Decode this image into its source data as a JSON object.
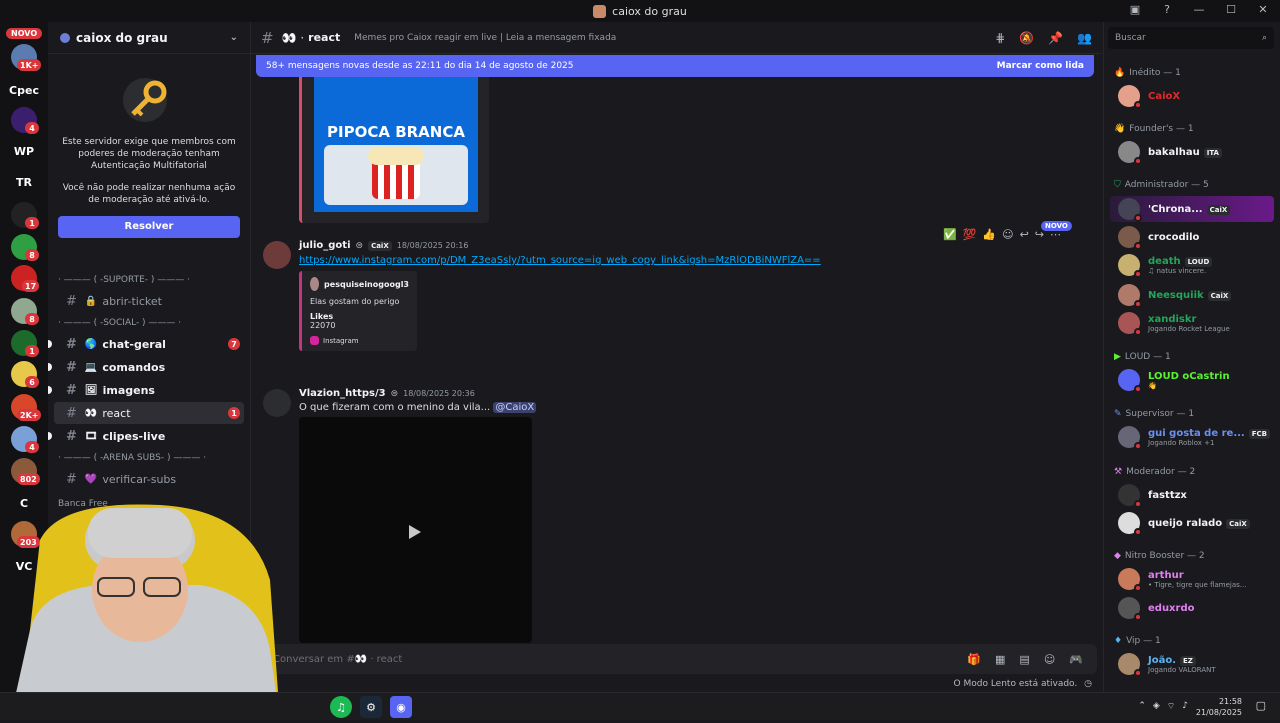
{
  "window": {
    "title": "caiox do grau"
  },
  "rail": {
    "novo": "NOVO",
    "items": [
      {
        "label": "",
        "badge": "1K+"
      },
      {
        "label": "Cpec",
        "badge": ""
      },
      {
        "label": "",
        "badge": "4"
      },
      {
        "label": "WP",
        "badge": ""
      },
      {
        "label": "TR",
        "badge": ""
      },
      {
        "label": "",
        "badge": "1"
      },
      {
        "label": "",
        "badge": "8"
      },
      {
        "label": "",
        "badge": "17"
      },
      {
        "label": "",
        "badge": "8"
      },
      {
        "label": "",
        "badge": "1"
      },
      {
        "label": "",
        "badge": "6"
      },
      {
        "label": "",
        "badge": "2K+"
      },
      {
        "label": "",
        "badge": "4"
      },
      {
        "label": "",
        "badge": "802"
      },
      {
        "label": "C",
        "badge": ""
      },
      {
        "label": "",
        "badge": "203"
      },
      {
        "label": "VC",
        "badge": ""
      }
    ]
  },
  "sidebar": {
    "server_name": "caiox do grau",
    "mfa_text": "Este servidor exige que membros com poderes de moderação tenham Autenticação Multifatorial",
    "mfa_text2": "Você não pode realizar nenhuma ação de moderação até ativá-lo.",
    "resolve": "Resolver",
    "cat_suporte": "· ——— ( -SUPORTE- ) ——— · ",
    "cat_social": "· ——— ( -SOCIAL- ) ——— · ",
    "cat_arena": "· ——— ( -ARENA SUBS- ) ——— · ",
    "cat_banca": "Banca Free",
    "channels": {
      "abrir_ticket": "abrir-ticket",
      "chat_geral": "chat-geral",
      "chat_geral_badge": "7",
      "comandos": "comandos",
      "imagens": "imagens",
      "react": "react",
      "react_badge": "1",
      "clipes_live": "clipes-live",
      "verificar_subs": "verificar-subs"
    }
  },
  "chat": {
    "header_channel": "react",
    "topic": "Memes pro Caiox reagir em live | Leia a mensagem fixada",
    "banner_text": "58+ mensagens novas desde as 22:11 do dia 14 de agosto de 2025",
    "banner_action": "Marcar como lida",
    "embed_title": "PIPOCA BRANCA",
    "messages": [
      {
        "author": "julio_goti",
        "tag": "CaiX",
        "time": "18/08/2025 20:16",
        "link": "https://www.instagram.com/p/DM_Z3eaSsly/?utm_source=ig_web_copy_link&igsh=MzRlODBiNWFlZA==",
        "ig_user": "pesquiseinogoogl3",
        "ig_caption": "Elas gostam do perigo",
        "ig_likes_label": "Likes",
        "ig_likes": "22070",
        "ig_footer": "Instagram"
      },
      {
        "author": "Vlazion_https/3",
        "time": "18/08/2025 20:36",
        "text": "O que fizeram com o menino da vila...",
        "mention": "@CaioX"
      }
    ],
    "novo_tag": "NOVO",
    "composer_placeholder": "Conversar em #👀 · react",
    "slow_mode": "O Modo Lento está ativado."
  },
  "members": {
    "search_placeholder": "Buscar",
    "groups": [
      {
        "role": "Inédito — 1",
        "members": [
          {
            "name": "CaioX",
            "color": "#e02a2a",
            "sub": "",
            "tag": ""
          }
        ]
      },
      {
        "role": "Founder's — 1",
        "members": [
          {
            "name": "bakalhau",
            "color": "#f2f3f5",
            "sub": "",
            "tag": "ITA"
          }
        ]
      },
      {
        "role": "Administrador — 5",
        "members": [
          {
            "name": "'Chrona...",
            "color": "#f2f3f5",
            "sub": "",
            "tag": "CaiX"
          },
          {
            "name": "crocodilo",
            "color": "#f2f3f5",
            "sub": "",
            "tag": ""
          },
          {
            "name": "death",
            "color": "#23a55a",
            "sub": "♫ natus vincere.",
            "tag": "LOUD"
          },
          {
            "name": "Neesquiik",
            "color": "#23a55a",
            "sub": "",
            "tag": "CaiX"
          },
          {
            "name": "xandiskr",
            "color": "#23a55a",
            "sub": "Jogando Rocket League",
            "tag": ""
          }
        ]
      },
      {
        "role": "LOUD — 1",
        "members": [
          {
            "name": "LOUD oCastrin",
            "color": "#5cf033",
            "sub": "👋",
            "tag": ""
          }
        ]
      },
      {
        "role": "Supervisor — 1",
        "members": [
          {
            "name": "gui gosta de re...",
            "color": "#6c8ff0",
            "sub": "Jogando Roblox +1",
            "tag": "FCB"
          }
        ]
      },
      {
        "role": "Moderador — 2",
        "members": [
          {
            "name": "fasttzx",
            "color": "#f2f3f5",
            "sub": "",
            "tag": ""
          },
          {
            "name": "queijo ralado",
            "color": "#f2f3f5",
            "sub": "",
            "tag": "CaiX"
          }
        ]
      },
      {
        "role": "Nitro Booster — 2",
        "members": [
          {
            "name": "arthur",
            "color": "#e07ff0",
            "sub": "• Tigre, tigre que flamejas...",
            "tag": ""
          },
          {
            "name": "eduxrdo",
            "color": "#e07ff0",
            "sub": "",
            "tag": ""
          }
        ]
      },
      {
        "role": "Vip — 1",
        "members": [
          {
            "name": "João.",
            "color": "#5ab4f0",
            "sub": "Jogando VALORANT",
            "tag": "EZ"
          }
        ]
      }
    ]
  },
  "taskbar": {
    "time": "21:58",
    "date": "21/08/2025"
  }
}
